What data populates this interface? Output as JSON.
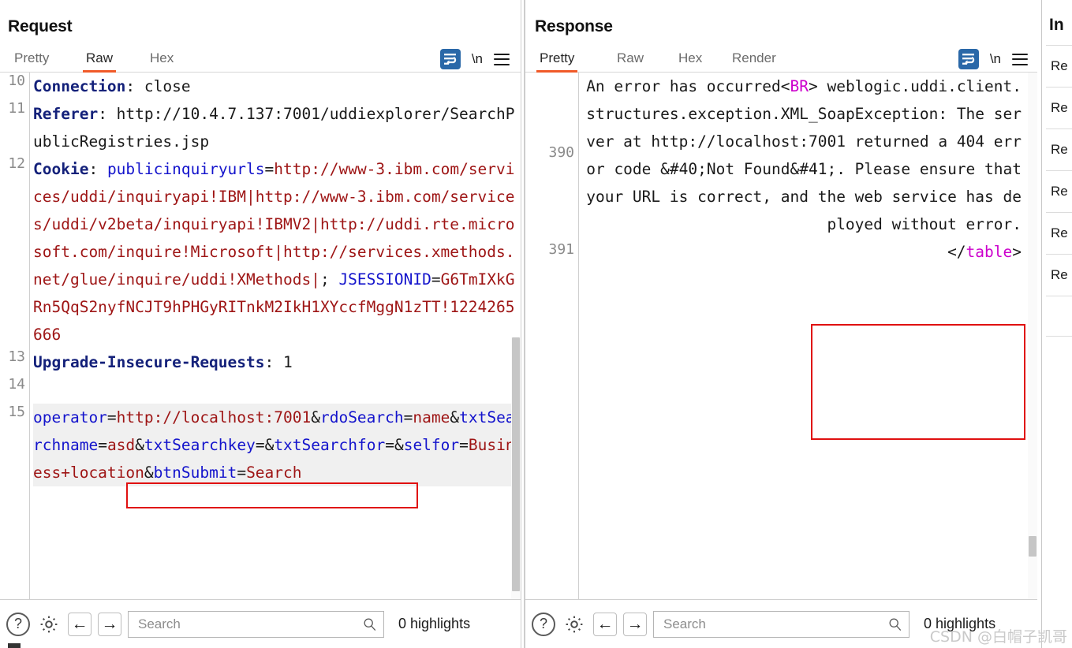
{
  "layout_toggles": [
    {
      "name": "side-by-side",
      "active": true
    },
    {
      "name": "stacked",
      "active": false
    },
    {
      "name": "single",
      "active": false
    }
  ],
  "request": {
    "title": "Request",
    "tabs": [
      {
        "label": "Pretty",
        "active": false
      },
      {
        "label": "Raw",
        "active": true
      },
      {
        "label": "Hex",
        "active": false
      }
    ],
    "icons": {
      "wrap": "word-wrap-icon",
      "newline": "\\n",
      "menu": "hamburger-menu-icon"
    },
    "lines": [
      {
        "no": "10",
        "segments": [
          {
            "t": "Connection",
            "c": "kw"
          },
          {
            "t": ": ",
            "c": "plain"
          },
          {
            "t": "close",
            "c": "plain"
          }
        ]
      },
      {
        "no": "11",
        "segments": [
          {
            "t": "Referer",
            "c": "kw"
          },
          {
            "t": ": ",
            "c": "plain"
          },
          {
            "t": "http://10.4.7.137:7001/uddiexplorer/SearchPublicRegistries.jsp",
            "c": "plain"
          }
        ]
      },
      {
        "no": "12",
        "segments": [
          {
            "t": "Cookie",
            "c": "kw"
          },
          {
            "t": ": ",
            "c": "plain"
          },
          {
            "t": "publicinquiryurls",
            "c": "blue"
          },
          {
            "t": "=",
            "c": "plain"
          },
          {
            "t": "http://www-3.ibm.com/services/uddi/inquiryapi!IBM|http://www-3.ibm.com/services/uddi/v2beta/inquiryapi!IBMV2|http://uddi.rte.microsoft.com/inquire!Microsoft|http://services.xmethods.net/glue/inquire/uddi!XMethods|",
            "c": "red"
          },
          {
            "t": "; ",
            "c": "plain"
          },
          {
            "t": "JSESSIONID",
            "c": "blue"
          },
          {
            "t": "=",
            "c": "plain"
          },
          {
            "t": "G6TmIXkGRn5QqS2nyfNCJT9hPHGyRITnkM2IkH1XYccfMggN1zTT!1224265666",
            "c": "red"
          }
        ]
      },
      {
        "no": "13",
        "segments": [
          {
            "t": "Upgrade-Insecure-Requests",
            "c": "kw"
          },
          {
            "t": ": ",
            "c": "plain"
          },
          {
            "t": "1",
            "c": "plain"
          }
        ]
      },
      {
        "no": "14",
        "segments": []
      },
      {
        "no": "15",
        "highlight": true,
        "segments": [
          {
            "t": "operator",
            "c": "blue"
          },
          {
            "t": "=",
            "c": "plain"
          },
          {
            "t": "http://localhost:7001",
            "c": "red"
          },
          {
            "t": "&",
            "c": "plain"
          },
          {
            "t": "rdoSearch",
            "c": "blue"
          },
          {
            "t": "=",
            "c": "plain"
          },
          {
            "t": "name",
            "c": "red"
          },
          {
            "t": "&",
            "c": "plain"
          },
          {
            "t": "txtSearchname",
            "c": "blue"
          },
          {
            "t": "=",
            "c": "plain"
          },
          {
            "t": "asd",
            "c": "red"
          },
          {
            "t": "&",
            "c": "plain"
          },
          {
            "t": "txtSearchkey",
            "c": "blue"
          },
          {
            "t": "=",
            "c": "plain"
          },
          {
            "t": "&",
            "c": "plain"
          },
          {
            "t": "txtSearchfor",
            "c": "blue"
          },
          {
            "t": "=",
            "c": "plain"
          },
          {
            "t": "&",
            "c": "plain"
          },
          {
            "t": "selfor",
            "c": "blue"
          },
          {
            "t": "=",
            "c": "plain"
          },
          {
            "t": "Business+location",
            "c": "red"
          },
          {
            "t": "&",
            "c": "plain"
          },
          {
            "t": "btnSubmit",
            "c": "blue"
          },
          {
            "t": "=",
            "c": "plain"
          },
          {
            "t": "Search",
            "c": "red"
          }
        ]
      }
    ],
    "annotation_box": "operator=http://localhost:7001&r",
    "bottom": {
      "help": "?",
      "settings": "gear-icon",
      "prev": "←",
      "next": "→",
      "search_value": "",
      "search_placeholder": "Search",
      "highlights": "0 highlights"
    }
  },
  "response": {
    "title": "Response",
    "tabs": [
      {
        "label": "Pretty",
        "active": true
      },
      {
        "label": "Raw",
        "active": false
      },
      {
        "label": "Hex",
        "active": false
      },
      {
        "label": "Render",
        "active": false
      }
    ],
    "icons": {
      "wrap": "word-wrap-icon",
      "newline": "\\n",
      "menu": "hamburger-menu-icon"
    },
    "lines": [
      {
        "no": "390",
        "segments": [
          {
            "t": "An error has occurred",
            "c": "plain"
          },
          {
            "t": "<",
            "c": "plain"
          },
          {
            "t": "BR",
            "c": "magenta"
          },
          {
            "t": ">",
            "c": "plain"
          },
          {
            "t": " weblogic.uddi.client.structures.exception.XML_SoapException: The server at http://localhost:7001 returned a 404 error code &#40;Not Found&#41;. Please ensure that your URL is correct, and the web service has deployed without error.",
            "c": "plain"
          }
        ]
      },
      {
        "no": "391",
        "segments": [
          {
            "t": "</",
            "c": "plain"
          },
          {
            "t": "table",
            "c": "magenta"
          },
          {
            "t": ">",
            "c": "plain"
          }
        ]
      }
    ],
    "annotation_box": "404 error code &#40;Not Found&#41;. Please ensure",
    "bottom": {
      "help": "?",
      "settings": "gear-icon",
      "prev": "←",
      "next": "→",
      "search_value": "",
      "search_placeholder": "Search",
      "highlights": "0 highlights"
    }
  },
  "inspector": {
    "title": "In",
    "rows": [
      "Re",
      "Re",
      "Re",
      "Re",
      "Re",
      "Re"
    ]
  },
  "watermark": "CSDN @白帽子凯哥",
  "colors": {
    "accent_orange": "#f05a28",
    "accent_blue": "#2a68a8",
    "annotation_red": "#e01010",
    "header_name": "#14217a",
    "param_blue": "#1414cc",
    "value_red": "#9e1515",
    "tag_magenta": "#cc00cc"
  }
}
